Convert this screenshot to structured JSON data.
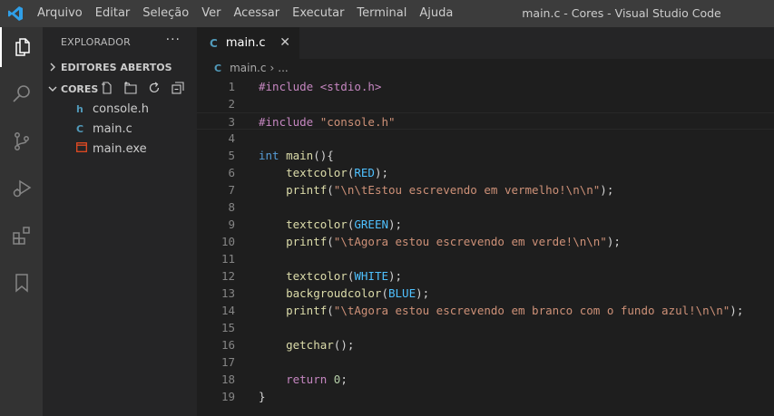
{
  "menu": [
    "Arquivo",
    "Editar",
    "Seleção",
    "Ver",
    "Acessar",
    "Executar",
    "Terminal",
    "Ajuda"
  ],
  "window_title": "main.c - Cores - Visual Studio Code",
  "activity_icons": [
    "files-icon",
    "search-icon",
    "source-control-icon",
    "run-debug-icon",
    "extensions-icon",
    "bookmarks-icon"
  ],
  "sidebar": {
    "title": "EXPLORADOR",
    "more": "···",
    "open_editors": "EDITORES ABERTOS",
    "folder": "CORES",
    "files": [
      {
        "name": "console.h",
        "icon": "h",
        "color": "#519aba"
      },
      {
        "name": "main.c",
        "icon": "C",
        "color": "#519aba"
      },
      {
        "name": "main.exe",
        "icon": "exe",
        "color": "#e44b23"
      }
    ]
  },
  "tab": {
    "icon": "C",
    "label": "main.c",
    "close": "✕"
  },
  "breadcrumb": {
    "icon": "C",
    "file": "main.c",
    "sep": "›",
    "rest": "..."
  },
  "code": [
    [
      [
        "#include <stdio.h>",
        "pp"
      ]
    ],
    [],
    [
      [
        "#include ",
        "pp"
      ],
      [
        "\"console.h\"",
        "str"
      ]
    ],
    [],
    [
      [
        "int",
        "kw"
      ],
      [
        " main",
        "fn"
      ],
      [
        "(){",
        "p"
      ]
    ],
    [
      [
        "    textcolor",
        "fn"
      ],
      [
        "(",
        "p"
      ],
      [
        "RED",
        "mac"
      ],
      [
        ");",
        "p"
      ]
    ],
    [
      [
        "    printf",
        "fn"
      ],
      [
        "(",
        "p"
      ],
      [
        "\"\\n\\tEstou escrevendo em vermelho!\\n\\n\"",
        "str"
      ],
      [
        ");",
        "p"
      ]
    ],
    [],
    [
      [
        "    textcolor",
        "fn"
      ],
      [
        "(",
        "p"
      ],
      [
        "GREEN",
        "mac"
      ],
      [
        ");",
        "p"
      ]
    ],
    [
      [
        "    printf",
        "fn"
      ],
      [
        "(",
        "p"
      ],
      [
        "\"\\tAgora estou escrevendo em verde!\\n\\n\"",
        "str"
      ],
      [
        ");",
        "p"
      ]
    ],
    [],
    [
      [
        "    textcolor",
        "fn"
      ],
      [
        "(",
        "p"
      ],
      [
        "WHITE",
        "mac"
      ],
      [
        ");",
        "p"
      ]
    ],
    [
      [
        "    backgroudcolor",
        "fn"
      ],
      [
        "(",
        "p"
      ],
      [
        "BLUE",
        "mac"
      ],
      [
        ");",
        "p"
      ]
    ],
    [
      [
        "    printf",
        "fn"
      ],
      [
        "(",
        "p"
      ],
      [
        "\"\\tAgora estou escrevendo em branco com o fundo azul!\\n\\n\"",
        "str"
      ],
      [
        ");",
        "p"
      ]
    ],
    [],
    [
      [
        "    getchar",
        "fn"
      ],
      [
        "();",
        "p"
      ]
    ],
    [],
    [
      [
        "    return",
        "ret"
      ],
      [
        " ",
        "p"
      ],
      [
        "0",
        "num"
      ],
      [
        ";",
        "p"
      ]
    ],
    [
      [
        "}",
        "p"
      ]
    ]
  ],
  "current_line": 3
}
